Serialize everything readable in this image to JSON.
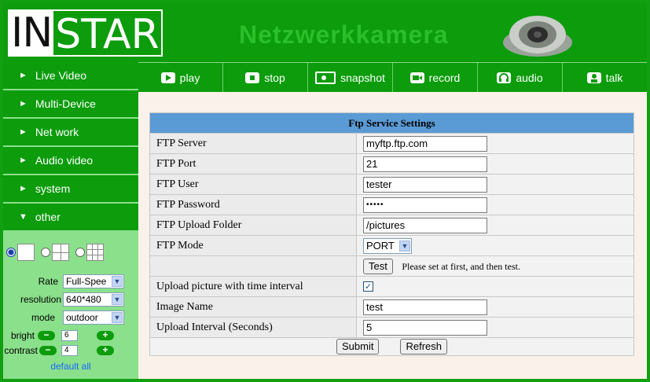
{
  "header": {
    "logo_in": "IN",
    "logo_star": "STAR",
    "subtitle": "Netzwerkkamera"
  },
  "toolbar": {
    "play": "play",
    "stop": "stop",
    "snapshot": "snapshot",
    "record": "record",
    "audio": "audio",
    "talk": "talk"
  },
  "sidebar": {
    "items": [
      {
        "label": "Live Video",
        "marker": "►"
      },
      {
        "label": "Multi-Device",
        "marker": "►"
      },
      {
        "label": "Net work",
        "marker": "►"
      },
      {
        "label": "Audio video",
        "marker": "►"
      },
      {
        "label": "system",
        "marker": "►"
      },
      {
        "label": "other",
        "marker": "▼"
      }
    ],
    "controls": {
      "rate_label": "Rate",
      "rate_value": "Full-Spee",
      "resolution_label": "resolution",
      "resolution_value": "640*480",
      "mode_label": "mode",
      "mode_value": "outdoor",
      "bright_label": "bright",
      "bright_value": "6",
      "contrast_label": "contrast",
      "contrast_value": "4",
      "minus": "−",
      "plus": "+",
      "default_all": "default all"
    }
  },
  "ftp": {
    "title": "Ftp Service Settings",
    "server_label": "FTP Server",
    "server_value": "myftp.ftp.com",
    "port_label": "FTP Port",
    "port_value": "21",
    "user_label": "FTP User",
    "user_value": "tester",
    "password_label": "FTP Password",
    "password_value": "•••••",
    "folder_label": "FTP Upload Folder",
    "folder_value": "/pictures",
    "mode_label": "FTP Mode",
    "mode_value": "PORT",
    "test_button": "Test",
    "test_hint": "Please set at first, and then test.",
    "upload_label": "Upload picture with time interval",
    "upload_checked": "✓",
    "image_name_label": "Image Name",
    "image_name_value": "test",
    "interval_label": "Upload Interval (Seconds)",
    "interval_value": "5",
    "submit": "Submit",
    "refresh": "Refresh"
  },
  "colors": {
    "brand_green": "#0c9c0c",
    "sidebar_bg": "#8be08b",
    "table_header": "#5b9bd5",
    "content_bg": "#f9f1ea"
  }
}
